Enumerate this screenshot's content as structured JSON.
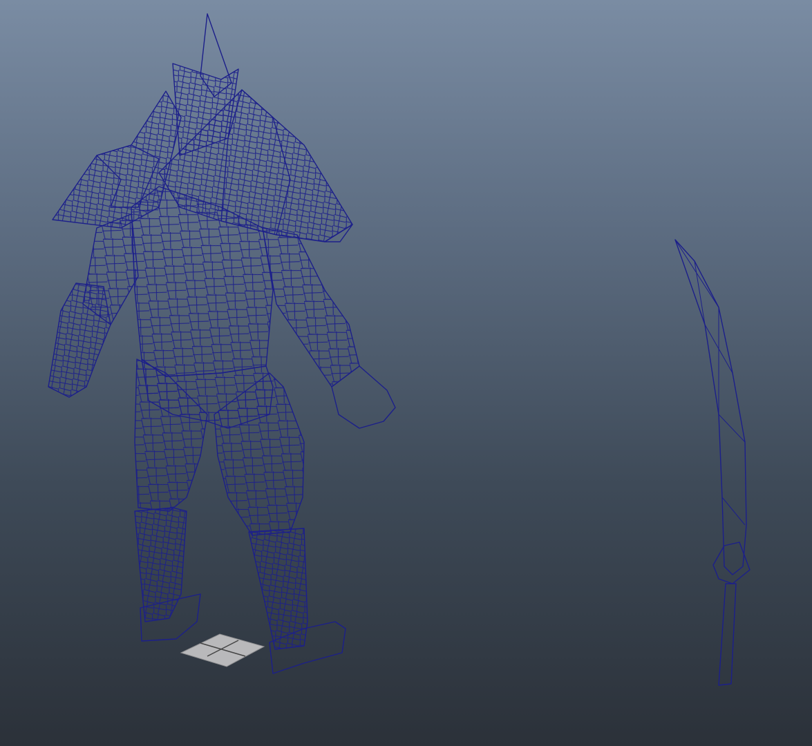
{
  "viewport": {
    "name": "3d-viewport",
    "background_top": "#7a8ca3",
    "background_bottom": "#2b3139"
  },
  "scene": {
    "objects": [
      "armored-character-mesh",
      "curved-sword-mesh",
      "origin-grid"
    ],
    "mesh_color": "#8e8e93",
    "wireframe_color": "#1c1f8a"
  }
}
